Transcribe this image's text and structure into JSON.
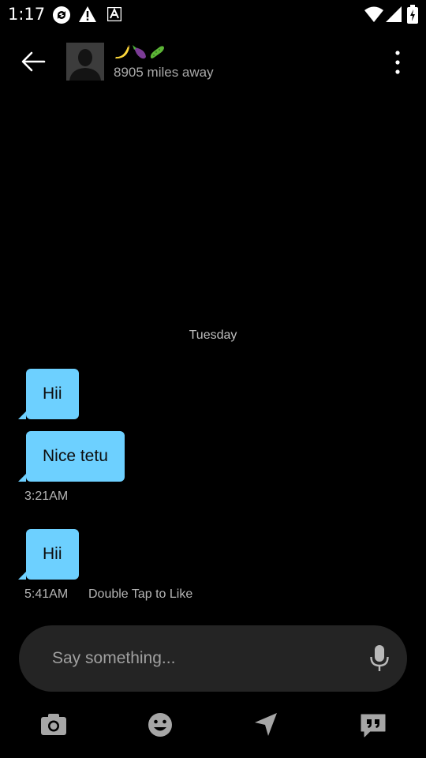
{
  "status_bar": {
    "time": "1:17",
    "icons": [
      "sync-icon",
      "warning-icon",
      "font-icon",
      "wifi-icon",
      "signal-icon",
      "battery-icon"
    ]
  },
  "header": {
    "contact_name": "🍌🍆🥒",
    "distance": "8905 miles away"
  },
  "chat": {
    "day_label": "Tuesday",
    "messages": [
      {
        "text": "Hii"
      },
      {
        "text": "Nice tetu",
        "time": "3:21AM"
      },
      {
        "text": "Hii",
        "time": "5:41AM",
        "hint": "Double Tap to Like"
      }
    ]
  },
  "composer": {
    "placeholder": "Say something..."
  },
  "toolbar": {
    "icons": [
      "camera-icon",
      "emoji-icon",
      "location-icon",
      "saved-phrases-icon"
    ]
  },
  "colors": {
    "background": "#000000",
    "bubble": "#6dd0ff",
    "composer": "#242424",
    "muted_text": "#a9a9a9"
  }
}
